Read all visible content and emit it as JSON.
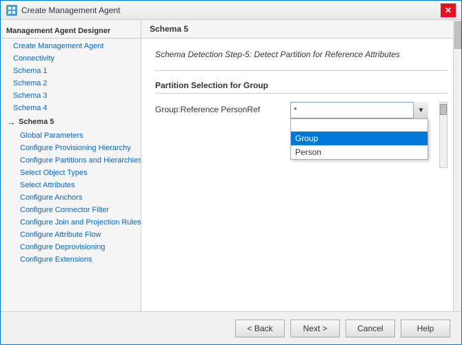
{
  "window": {
    "title": "Create Management Agent",
    "icon_label": "MA",
    "close_label": "✕"
  },
  "sidebar": {
    "title_label": "Management Agent Designer",
    "items": [
      {
        "id": "create-management-agent",
        "label": "Create Management Agent",
        "indent": false,
        "active": false
      },
      {
        "id": "connectivity",
        "label": "Connectivity",
        "indent": false,
        "active": false
      },
      {
        "id": "schema-1",
        "label": "Schema 1",
        "indent": false,
        "active": false
      },
      {
        "id": "schema-2",
        "label": "Schema 2",
        "indent": false,
        "active": false
      },
      {
        "id": "schema-3",
        "label": "Schema 3",
        "indent": false,
        "active": false
      },
      {
        "id": "schema-4",
        "label": "Schema 4",
        "indent": false,
        "active": false
      },
      {
        "id": "schema-5",
        "label": "Schema 5",
        "indent": false,
        "active": true,
        "has_arrow": true
      },
      {
        "id": "global-parameters",
        "label": "Global Parameters",
        "indent": true,
        "active": false
      },
      {
        "id": "configure-provisioning-hierarchy",
        "label": "Configure Provisioning Hierarchy",
        "indent": true,
        "active": false
      },
      {
        "id": "configure-partitions-and-hierarchies",
        "label": "Configure Partitions and Hierarchies",
        "indent": true,
        "active": false
      },
      {
        "id": "select-object-types",
        "label": "Select Object Types",
        "indent": true,
        "active": false
      },
      {
        "id": "select-attributes",
        "label": "Select Attributes",
        "indent": true,
        "active": false
      },
      {
        "id": "configure-anchors",
        "label": "Configure Anchors",
        "indent": true,
        "active": false
      },
      {
        "id": "configure-connector-filter",
        "label": "Configure Connector Filter",
        "indent": true,
        "active": false
      },
      {
        "id": "configure-join-and-projection-rules",
        "label": "Configure Join and Projection Rules",
        "indent": true,
        "active": false
      },
      {
        "id": "configure-attribute-flow",
        "label": "Configure Attribute Flow",
        "indent": true,
        "active": false
      },
      {
        "id": "configure-deprovisioning",
        "label": "Configure Deprovisioning",
        "indent": true,
        "active": false
      },
      {
        "id": "configure-extensions",
        "label": "Configure Extensions",
        "indent": true,
        "active": false
      }
    ]
  },
  "main": {
    "header_label": "Schema 5",
    "section_title": "Schema Detection Step-5: Detect Partition for Reference Attributes",
    "partition_section_title": "Partition Selection for Group",
    "field_label": "Group:Reference PersonRef",
    "dropdown_value": "*",
    "dropdown_options": [
      {
        "label": "",
        "value": "",
        "selected": false,
        "empty": true
      },
      {
        "label": "Group",
        "value": "Group",
        "selected": true
      },
      {
        "label": "Person",
        "value": "Person",
        "selected": false
      }
    ]
  },
  "footer": {
    "back_label": "< Back",
    "next_label": "Next >",
    "cancel_label": "Cancel",
    "help_label": "Help"
  }
}
